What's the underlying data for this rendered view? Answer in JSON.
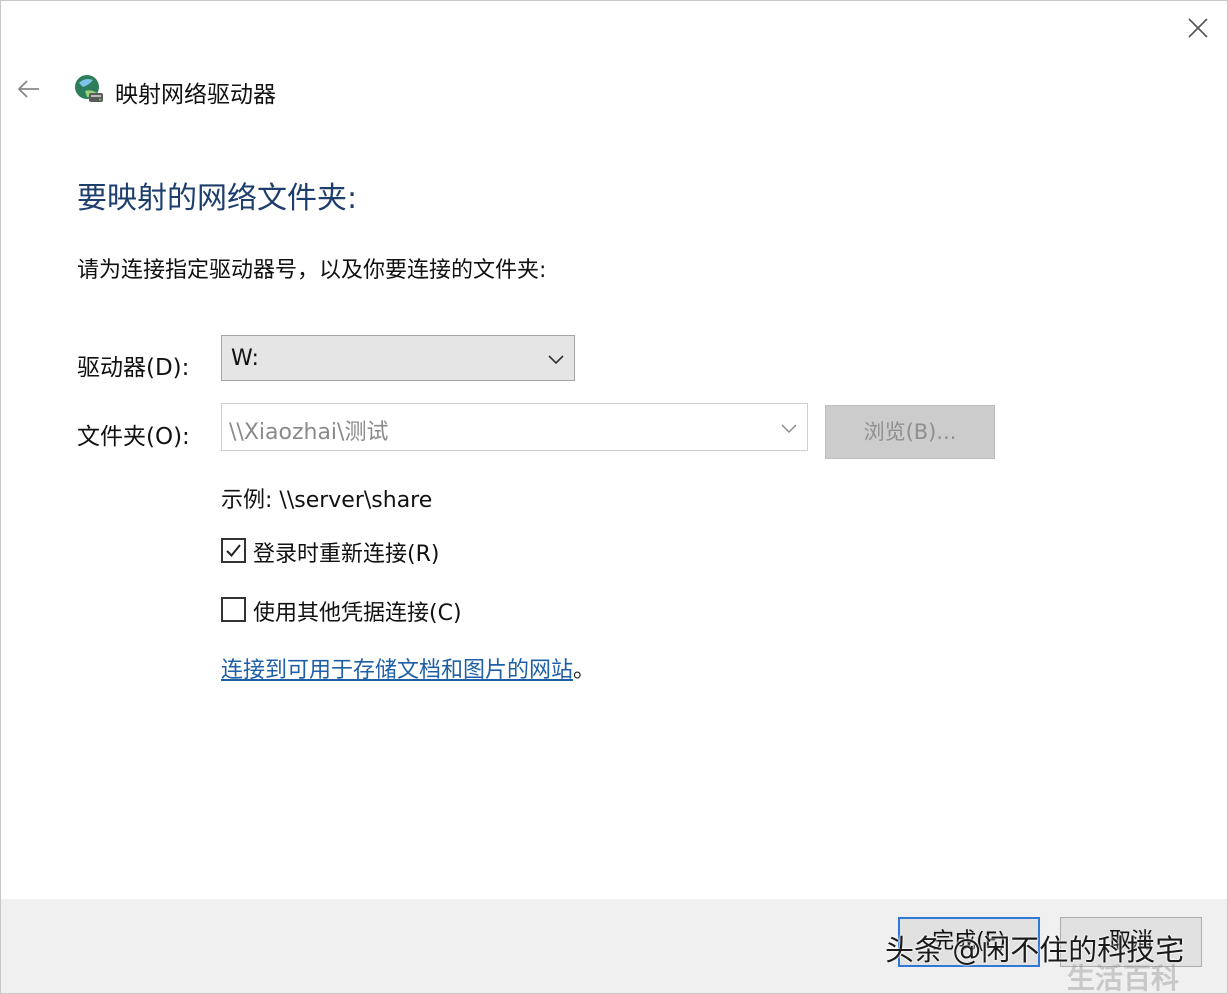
{
  "window": {
    "title": "映射网络驱动器",
    "close_icon": "close-icon",
    "back_icon": "back-arrow-icon",
    "app_icon": "network-drive-icon"
  },
  "main": {
    "heading": "要映射的网络文件夹:",
    "instruction": "请为连接指定驱动器号，以及你要连接的文件夹:"
  },
  "drive": {
    "label": "驱动器(D):",
    "value": "W:"
  },
  "folder": {
    "label": "文件夹(O):",
    "value": "\\\\Xiaozhai\\测试",
    "browse_label": "浏览(B)..."
  },
  "example": "示例: \\\\server\\share",
  "options": {
    "reconnect_label": "登录时重新连接(R)",
    "reconnect_checked": true,
    "credentials_label": "使用其他凭据连接(C)",
    "credentials_checked": false
  },
  "link": {
    "text": "连接到可用于存储文档和图片的网站",
    "suffix": "。"
  },
  "footer": {
    "finish_label": "完成(F)",
    "cancel_label": "取消"
  },
  "watermark": {
    "primary": "头条 @闲不住的科技宅",
    "secondary": "生活百科"
  },
  "colors": {
    "heading": "#1e3f6e",
    "link": "#1f5fa8",
    "focus_border": "#2f78d6"
  }
}
